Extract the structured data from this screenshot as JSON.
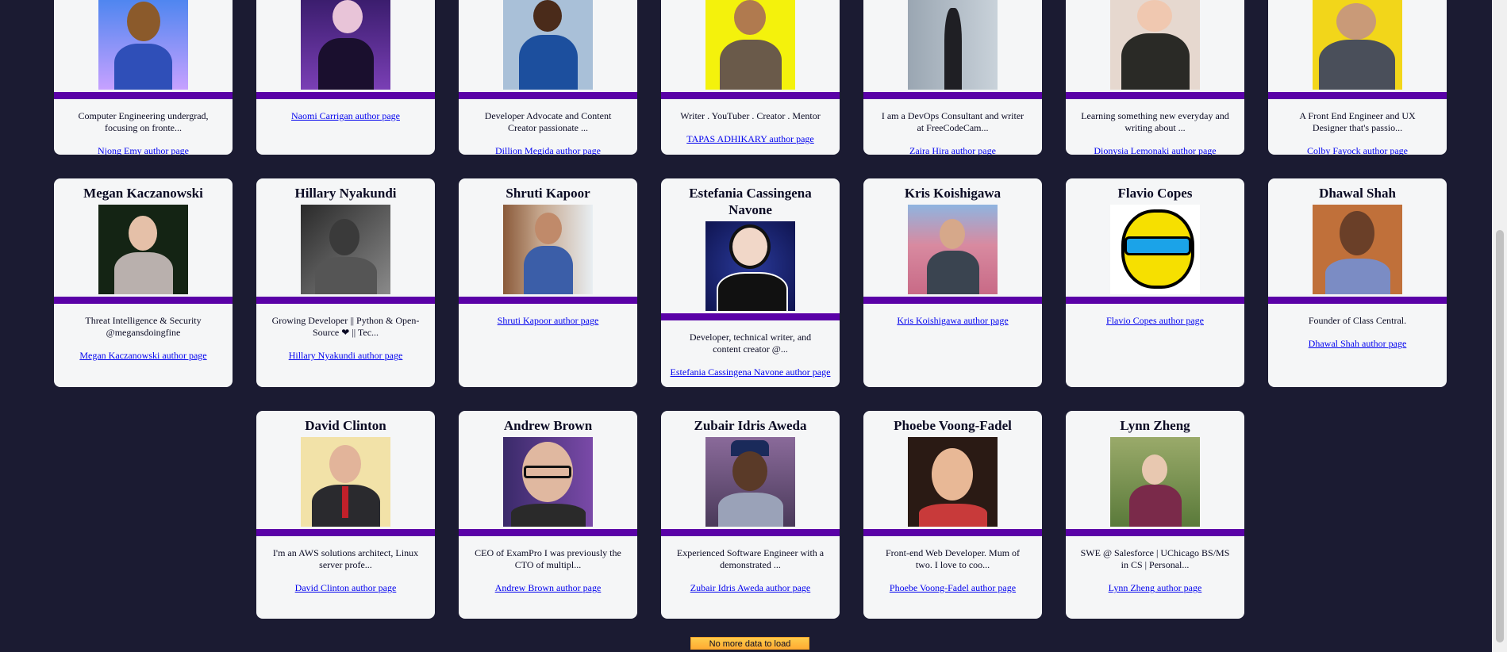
{
  "authors_row1": [
    {
      "bio": "Computer Engineering undergrad, focusing on fronte...",
      "link": "Njong Emy author page"
    },
    {
      "bio": "",
      "link": "Naomi Carrigan author page"
    },
    {
      "bio": "Developer Advocate and Content Creator passionate ...",
      "link": "Dillion Megida author page"
    },
    {
      "bio": "Writer . YouTuber . Creator . Mentor",
      "link": "TAPAS ADHIKARY author page"
    },
    {
      "bio": "I am a DevOps Consultant and writer at FreeCodeCam...",
      "link": "Zaira Hira author page"
    },
    {
      "bio": "Learning something new everyday and writing about ...",
      "link": "Dionysia Lemonaki author page"
    },
    {
      "bio": "A Front End Engineer and UX Designer that's passio...",
      "link": "Colby Fayock author page"
    }
  ],
  "authors_row2": [
    {
      "name": "Megan Kaczanowski",
      "bio": "Threat Intelligence & Security @megansdoingfine",
      "link": "Megan Kaczanowski author page"
    },
    {
      "name": "Hillary Nyakundi",
      "bio": "Growing Developer || Python & Open-Source ❤ || Tec...",
      "link": "Hillary Nyakundi author page"
    },
    {
      "name": "Shruti Kapoor",
      "bio": "",
      "link": "Shruti Kapoor author page"
    },
    {
      "name": "Estefania Cassingena Navone",
      "bio": "Developer, technical writer, and content creator @...",
      "link": "Estefania Cassingena Navone author page"
    },
    {
      "name": "Kris Koishigawa",
      "bio": "",
      "link": "Kris Koishigawa author page"
    },
    {
      "name": "Flavio Copes",
      "bio": "",
      "link": "Flavio Copes author page"
    },
    {
      "name": "Dhawal Shah",
      "bio": "Founder of Class Central.",
      "link": "Dhawal Shah author page"
    }
  ],
  "authors_row3": [
    {
      "name": "David Clinton",
      "bio": "I'm an AWS solutions architect, Linux server profe...",
      "link": "David Clinton author page"
    },
    {
      "name": "Andrew Brown",
      "bio": "CEO of ExamPro I was previously the CTO of multipl...",
      "link": "Andrew Brown author page"
    },
    {
      "name": "Zubair Idris Aweda",
      "bio": "Experienced Software Engineer with a demonstrated ...",
      "link": "Zubair Idris Aweda author page"
    },
    {
      "name": "Phoebe Voong-Fadel",
      "bio": "Front-end Web Developer. Mum of two. I love to coo...",
      "link": "Phoebe Voong-Fadel author page"
    },
    {
      "name": "Lynn Zheng",
      "bio": "SWE @ Salesforce | UChicago BS/MS in CS | Personal...",
      "link": "Lynn Zheng author page"
    }
  ],
  "load_button": "No more data to load",
  "colors": {
    "page_bg": "#1b1b32",
    "card_bg": "#f5f6f7",
    "accent_bar": "#5a01a7",
    "button": "#feac32",
    "link": "#0000ee"
  }
}
